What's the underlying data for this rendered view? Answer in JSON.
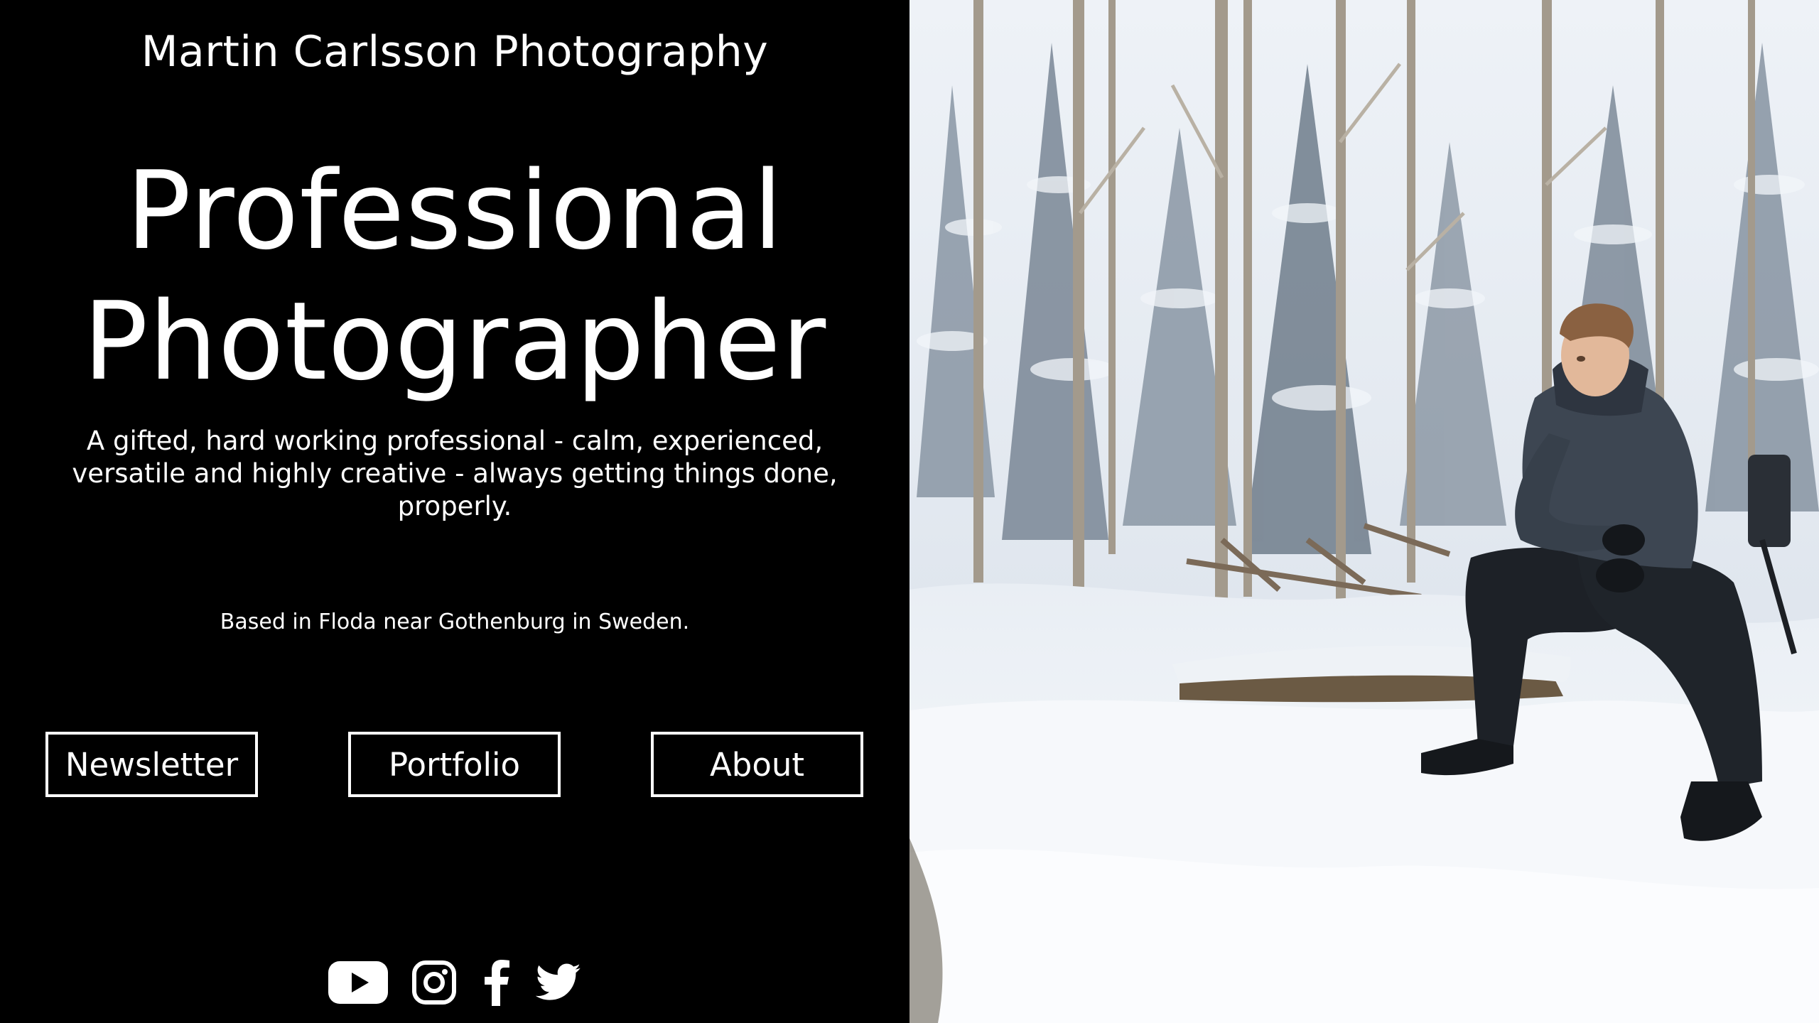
{
  "site": {
    "title": "Martin Carlsson Photography"
  },
  "hero": {
    "headline_line1": "Professional",
    "headline_line2": "Photographer",
    "tagline": "A gifted, hard working professional - calm, experienced, versatile and highly creative - always getting things done, properly.",
    "location": "Based in Floda near Gothenburg in Sweden."
  },
  "nav": {
    "newsletter": "Newsletter",
    "portfolio": "Portfolio",
    "about": "About"
  },
  "social": [
    {
      "name": "youtube-icon"
    },
    {
      "name": "instagram-icon"
    },
    {
      "name": "facebook-icon"
    },
    {
      "name": "twitter-icon"
    }
  ],
  "colors": {
    "background": "#000000",
    "text": "#ffffff",
    "snow": "#f4f7fa",
    "jacket": "#3d4652"
  }
}
